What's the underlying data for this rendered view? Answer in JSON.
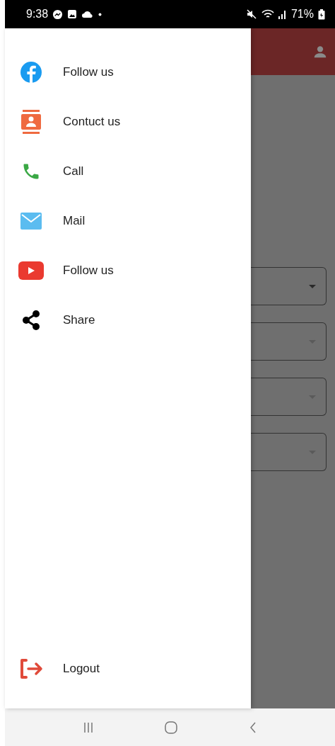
{
  "status_bar": {
    "time": "9:38",
    "battery": "71%"
  },
  "drawer": {
    "items": [
      {
        "kind": "facebook",
        "label": "Follow us"
      },
      {
        "kind": "contact",
        "label": "Contuct us"
      },
      {
        "kind": "call",
        "label": "Call"
      },
      {
        "kind": "mail",
        "label": "Mail"
      },
      {
        "kind": "youtube",
        "label": "Follow us"
      },
      {
        "kind": "share",
        "label": "Share"
      }
    ],
    "footer": {
      "kind": "logout",
      "label": "Logout"
    }
  },
  "dropdowns": [
    {
      "disabled": false
    },
    {
      "disabled": true
    },
    {
      "disabled": true
    },
    {
      "disabled": true
    }
  ]
}
